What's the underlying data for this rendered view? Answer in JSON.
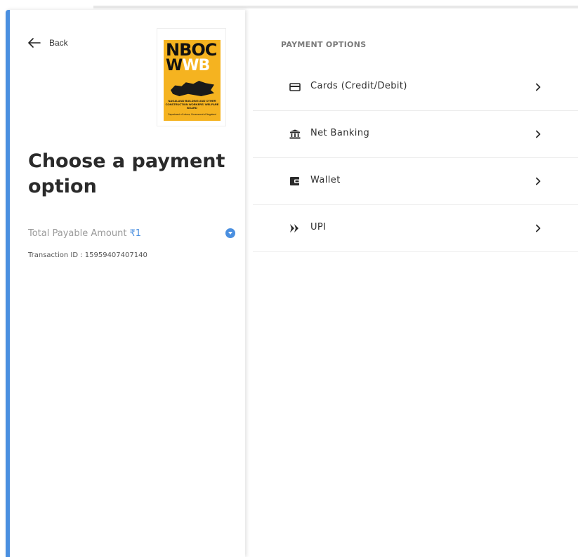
{
  "left": {
    "back_label": "Back",
    "logo": {
      "line1": "NBOC",
      "line2_w": "W",
      "line2_wb": "WB",
      "caption": "NAGALAND BUILDING AND OTHER CONSTRUCTION WORKERS' WELFARE BOARD",
      "subcaption": "Department of Labour, Government of Nagaland"
    },
    "title": "Choose a payment option",
    "amount_label": "Total Payable Amount",
    "amount_value": "₹1",
    "transaction": "Transaction ID : 15959407407140"
  },
  "right": {
    "section_label": "PAYMENT OPTIONS",
    "options": [
      {
        "label": "Cards (Credit/Debit)",
        "icon": "card-icon"
      },
      {
        "label": "Net Banking",
        "icon": "bank-icon"
      },
      {
        "label": "Wallet",
        "icon": "wallet-icon"
      },
      {
        "label": "UPI",
        "icon": "upi-icon"
      }
    ]
  },
  "colors": {
    "accent": "#4a8fe0",
    "logo_bg": "#f5b320"
  }
}
